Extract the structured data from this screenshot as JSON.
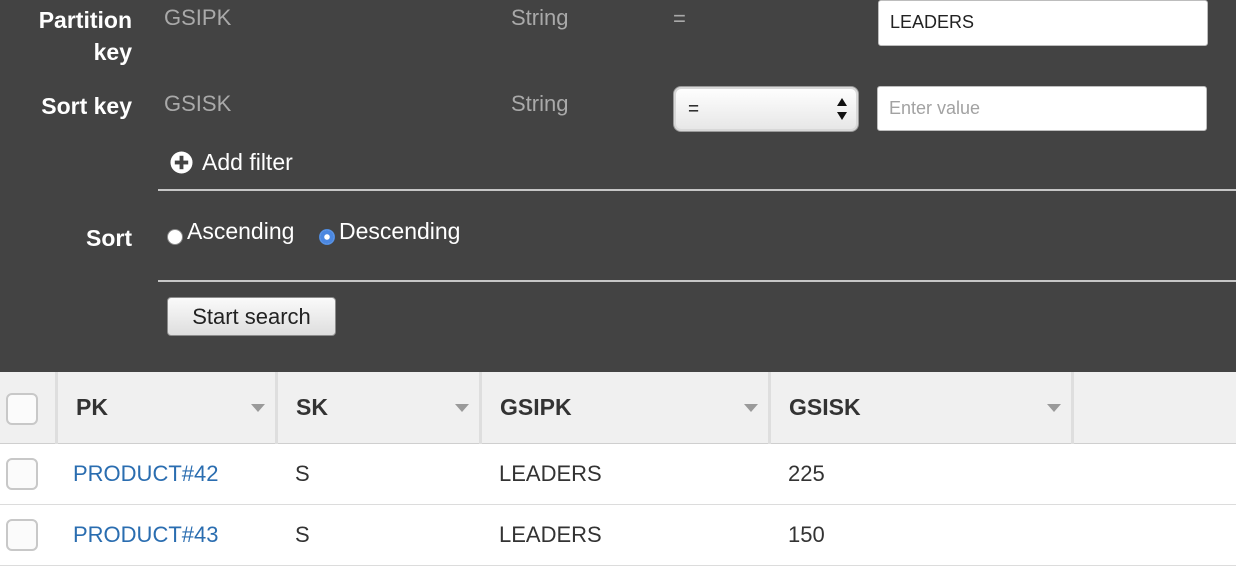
{
  "query": {
    "partition_key": {
      "label": "Partition key",
      "attribute": "GSIPK",
      "type": "String",
      "operator": "=",
      "value": "LEADERS"
    },
    "sort_key": {
      "label": "Sort key",
      "attribute": "GSISK",
      "type": "String",
      "operator": "=",
      "placeholder": "Enter value"
    },
    "add_filter_label": "Add filter",
    "sort": {
      "label": "Sort",
      "options": [
        "Ascending",
        "Descending"
      ],
      "selected": "Descending"
    },
    "start_search_label": "Start search"
  },
  "table": {
    "columns": [
      "PK",
      "SK",
      "GSIPK",
      "GSISK"
    ],
    "rows": [
      [
        "PRODUCT#42",
        "S",
        "LEADERS",
        "225"
      ],
      [
        "PRODUCT#43",
        "S",
        "LEADERS",
        "150"
      ]
    ]
  },
  "colors": {
    "panel_bg": "#434343",
    "link": "#2a6db0",
    "radio_selected": "#4b87e0"
  },
  "icons": {
    "add_filter": "plus-circle-icon",
    "select_arrows": "up-down-chevron-icon",
    "column_sort": "caret-down-icon"
  }
}
